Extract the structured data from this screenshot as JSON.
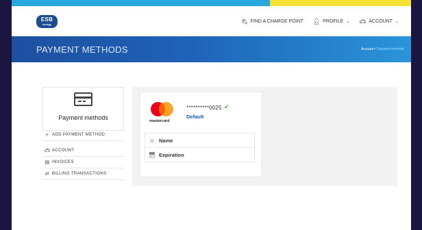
{
  "colors": {
    "brand_blue": "#1b4d8f",
    "top_blue": "#2aa7dd",
    "top_yellow": "#f3e136",
    "check_green": "#4caf50"
  },
  "logo": {
    "line1": "ESB",
    "line2": "energy"
  },
  "nav": {
    "charge": {
      "icon": "plug-icon",
      "label": "FIND A CHARGE POINT"
    },
    "profile": {
      "icon": "user-icon",
      "label": "PROFILE"
    },
    "account": {
      "icon": "car-icon",
      "label": "ACCOUNT"
    }
  },
  "hero": {
    "title": "PAYMENT METHODS",
    "breadcrumb": {
      "root": "Account",
      "sep": "•",
      "current": "Payment methods"
    }
  },
  "sidebar": {
    "card_title": "Payment methods",
    "actions": [
      {
        "icon": "plus-icon",
        "label": "ADD PAYMENT METHOD"
      }
    ],
    "items": [
      {
        "icon": "car-icon",
        "label": "ACCOUNT"
      },
      {
        "icon": "invoice-icon",
        "label": "INVOICES"
      },
      {
        "icon": "transfer-icon",
        "label": "BILLING TRANSACTIONS"
      }
    ]
  },
  "payment_card": {
    "brand": "mastercard",
    "number": "**********0025",
    "status_icon": "check-icon",
    "default_label": "Default",
    "rows": [
      {
        "icon": "user-circle-icon",
        "label": "Name"
      },
      {
        "icon": "calendar-icon",
        "label": "Expiration"
      }
    ]
  }
}
